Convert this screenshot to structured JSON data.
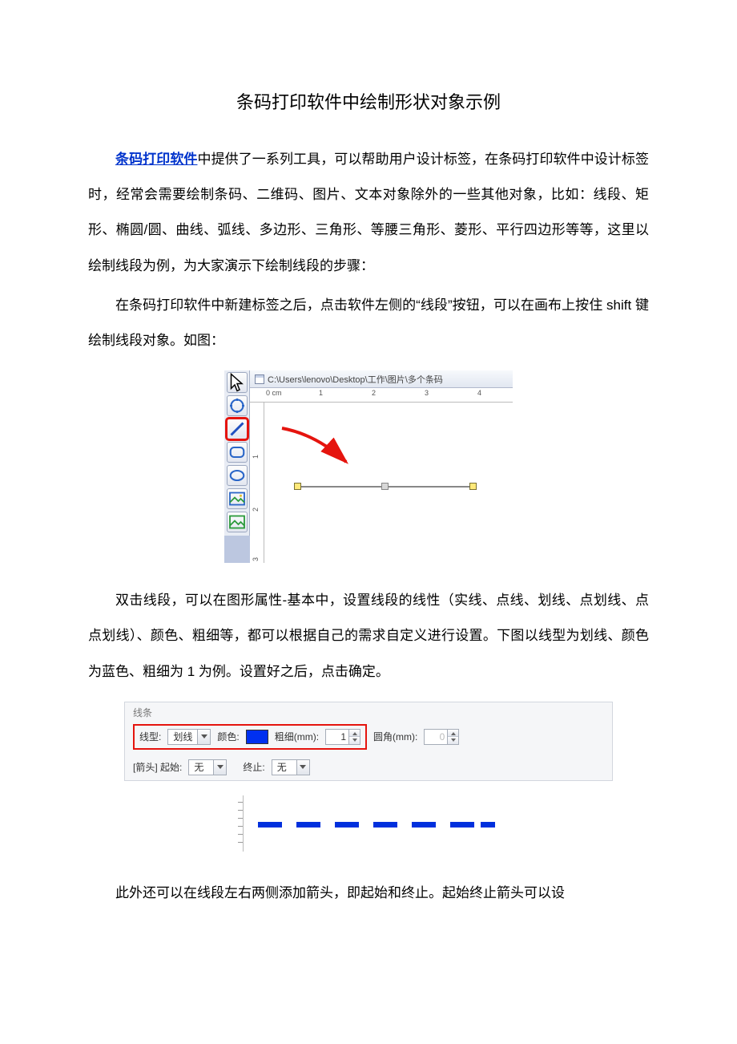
{
  "title": "条码打印软件中绘制形状对象示例",
  "link_label": "条码打印软件",
  "p1_after_link": "中提供了一系列工具，可以帮助用户设计标签，在条码打印软件中设计标签时，经常会需要绘制条码、二维码、图片、文本对象除外的一些其他对象，比如：线段、矩形、椭圆/圆、曲线、弧线、多边形、三角形、等腰三角形、菱形、平行四边形等等，这里以绘制线段为例，为大家演示下绘制线段的步骤：",
  "p2": "在条码打印软件中新建标签之后，点击软件左侧的“线段”按钮，可以在画布上按住 shift 键绘制线段对象。如图：",
  "p3": "双击线段，可以在图形属性-基本中，设置线段的线性（实线、点线、划线、点划线、点点划线）、颜色、粗细等，都可以根据自己的需求自定义进行设置。下图以线型为划线、颜色为蓝色、粗细为 1 为例。设置好之后，点击确定。",
  "p4": "此外还可以在线段左右两侧添加箭头，即起始和终止。起始终止箭头可以设",
  "canvas": {
    "path": "C:\\Users\\lenovo\\Desktop\\工作\\图片\\多个条码",
    "ruler_unit": "0 cm",
    "ruler_ticks": [
      "1",
      "2",
      "3",
      "4"
    ],
    "vruler_ticks": [
      "1",
      "2",
      "3"
    ]
  },
  "panel": {
    "group_label": "线条",
    "line_type_label": "线型:",
    "line_type_value": "划线",
    "color_label": "颜色:",
    "thickness_label": "粗细(mm):",
    "thickness_value": "1",
    "corner_label": "圆角(mm):",
    "corner_value": "0",
    "arrow_group": "[箭头] 起始:",
    "arrow_start_value": "无",
    "arrow_end_label": "终止:",
    "arrow_end_value": "无"
  }
}
